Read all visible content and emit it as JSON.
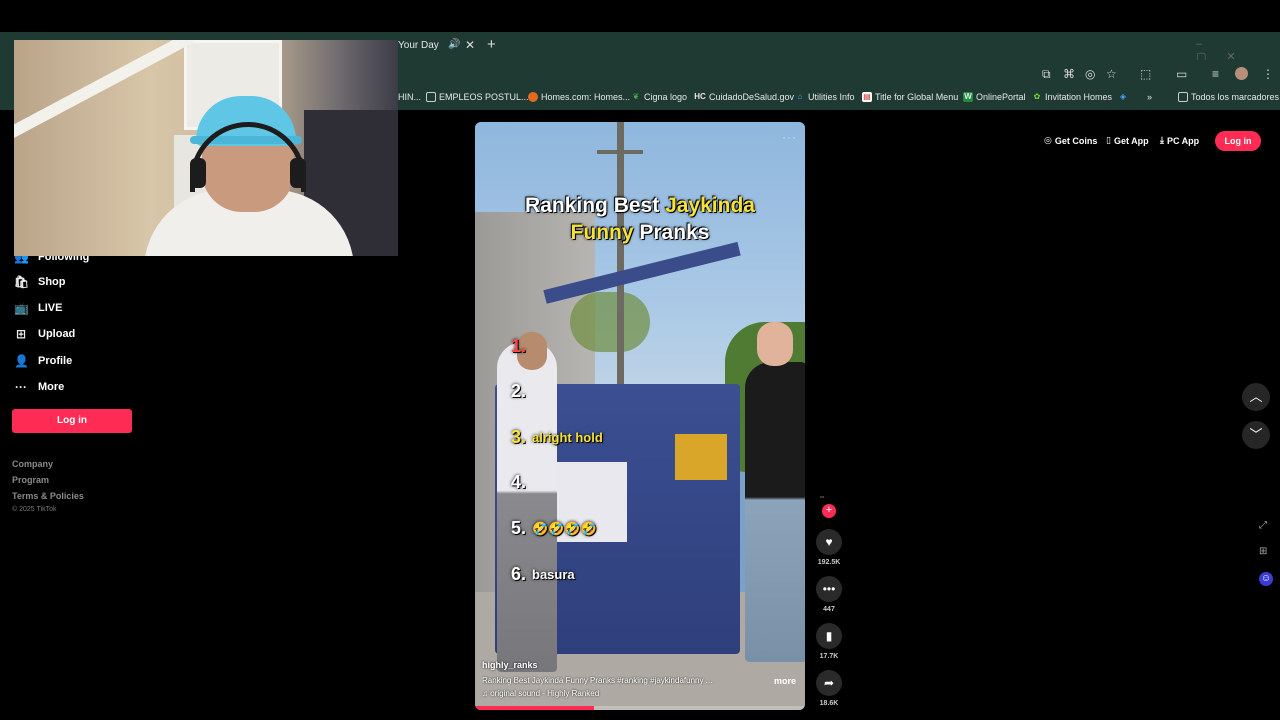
{
  "browser": {
    "tab_title": "Your Day",
    "bookmarks": [
      {
        "label": "HIN...",
        "icon": ""
      },
      {
        "label": "EMPLEOS POSTUL...",
        "icon": "folder"
      },
      {
        "label": "Homes.com: Homes...",
        "icon": "homes"
      },
      {
        "label": "Cigna logo",
        "icon": "cigna"
      },
      {
        "label": "CuidadoDeSalud.gov",
        "icon": "HC"
      },
      {
        "label": "Utilities Info",
        "icon": "home"
      },
      {
        "label": "Title for Global Menu",
        "icon": "doc"
      },
      {
        "label": "OnlinePortal",
        "icon": "W"
      },
      {
        "label": "Invitation Homes",
        "icon": "leaf"
      },
      {
        "label": "Todos los marcadores",
        "icon": "folder"
      }
    ]
  },
  "sidebar": {
    "items": [
      {
        "label": "Following",
        "icon": "following-icon"
      },
      {
        "label": "Shop",
        "icon": "shop-icon"
      },
      {
        "label": "LIVE",
        "icon": "live-icon"
      },
      {
        "label": "Upload",
        "icon": "upload-icon"
      },
      {
        "label": "Profile",
        "icon": "profile-icon"
      },
      {
        "label": "More",
        "icon": "more-icon"
      }
    ],
    "login_label": "Log in",
    "footer": [
      "Company",
      "Program",
      "Terms & Policies"
    ],
    "copyright": "© 2025 TikTok"
  },
  "header": {
    "get_coins": "Get Coins",
    "get_app": "Get App",
    "pc_app": "PC App",
    "login": "Log in"
  },
  "video": {
    "title_part1": "Ranking Best ",
    "title_highlight1": "Jaykinda",
    "title_highlight2": "Funny",
    "title_part2": " Pranks",
    "ranks": [
      {
        "num": "1.",
        "label": ""
      },
      {
        "num": "2.",
        "label": ""
      },
      {
        "num": "3.",
        "label": "alright hold"
      },
      {
        "num": "4.",
        "label": ""
      },
      {
        "num": "5.",
        "label": "🤣🤣🤣🤣"
      },
      {
        "num": "6.",
        "label": "basura"
      }
    ],
    "author": "highly_ranks",
    "description": "Ranking Best Jaykinda Funny Pranks #ranking #jaykindafunny ...",
    "more": "more",
    "sound": "♫ original sound - Highly Ranked",
    "progress": 0.36
  },
  "actions": {
    "likes": "192.5K",
    "comments": "447",
    "saves": "17.7K",
    "shares": "18.6K"
  },
  "colors": {
    "accent": "#fe2c55",
    "chrome": "#1f3a33",
    "highlight": "#f5e23a"
  }
}
